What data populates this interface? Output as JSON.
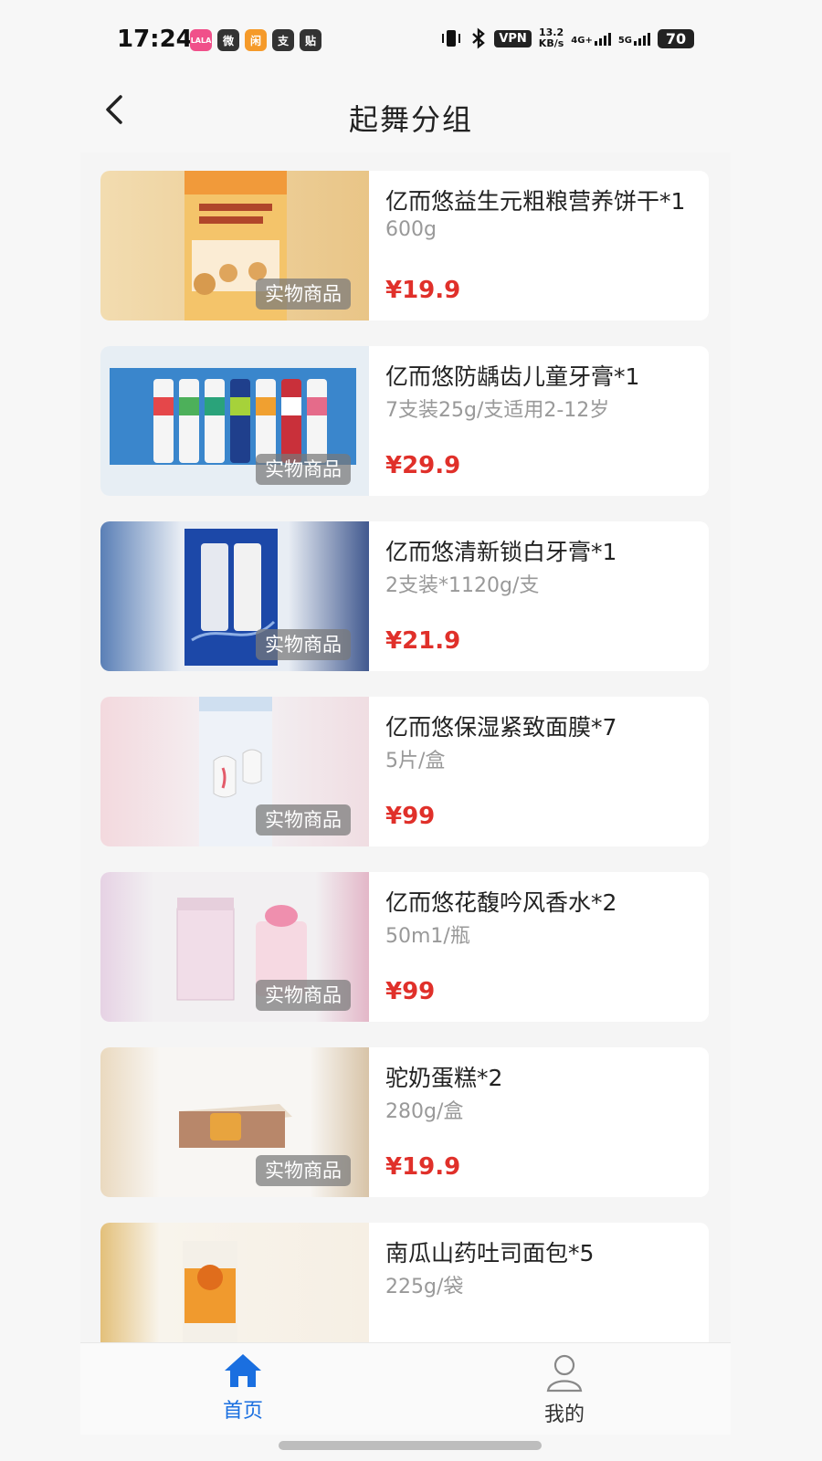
{
  "status": {
    "time": "17:24",
    "apps": [
      {
        "label": "LALA",
        "color": "#f0508a"
      },
      {
        "label": "微",
        "color": "#333333"
      },
      {
        "label": "闲",
        "color": "#f59a2a"
      },
      {
        "label": "支",
        "color": "#333333"
      },
      {
        "label": "贴",
        "color": "#333333"
      }
    ],
    "vpn": "VPN",
    "speed_value": "13.2",
    "speed_unit": "KB/s",
    "net1": "4G+",
    "net2": "5G",
    "battery": "70"
  },
  "nav": {
    "title": "起舞分组",
    "back_icon": "chevron-left-icon"
  },
  "tag_label": "实物商品",
  "products": [
    {
      "name": "亿而悠益生元粗粮营养饼干*1",
      "spec": "600g",
      "price": "¥19.9"
    },
    {
      "name": "亿而悠防龋齿儿童牙膏*1",
      "spec": "7支装25g/支适用2-12岁",
      "price": "¥29.9"
    },
    {
      "name": "亿而悠清新锁白牙膏*1",
      "spec": "2支装*1120g/支",
      "price": "¥21.9"
    },
    {
      "name": "亿而悠保湿紧致面膜*7",
      "spec": "5片/盒",
      "price": "¥99"
    },
    {
      "name": "亿而悠花馥吟风香水*2",
      "spec": "50m1/瓶",
      "price": "¥99"
    },
    {
      "name": "驼奶蛋糕*2",
      "spec": "280g/盒",
      "price": "¥19.9"
    },
    {
      "name": "南瓜山药吐司面包*5",
      "spec": "225g/袋",
      "price": ""
    }
  ],
  "tabs": {
    "home": {
      "label": "首页",
      "icon": "home-icon"
    },
    "mine": {
      "label": "我的",
      "icon": "user-icon"
    }
  },
  "colors": {
    "price": "#e0302a",
    "accent": "#1a6fe0"
  }
}
